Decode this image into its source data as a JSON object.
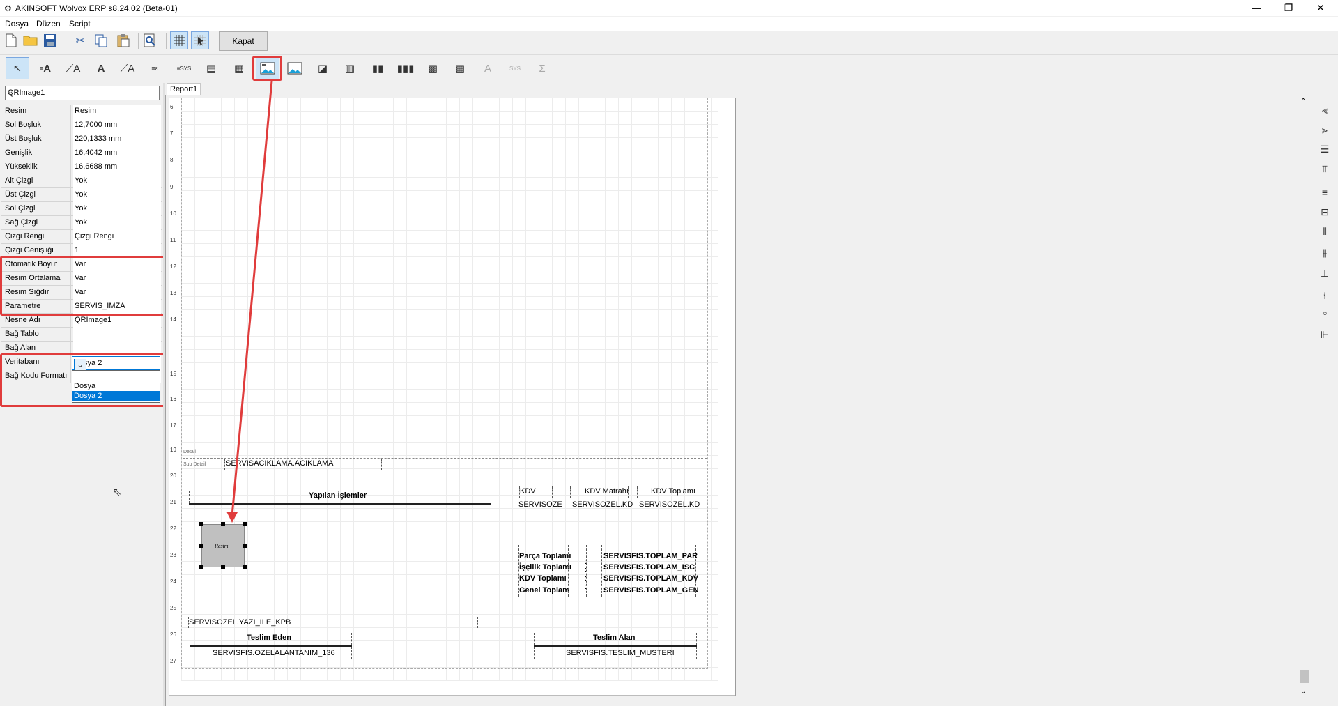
{
  "window": {
    "title": "AKINSOFT Wolvox ERP s8.24.02 (Beta-01)",
    "minimize_label": "—",
    "restore_label": "❐",
    "close_label": "✕"
  },
  "menu": {
    "items": [
      "Dosya",
      "Düzen",
      "Script"
    ]
  },
  "toolbar": {
    "close_button": "Kapat"
  },
  "object_selector": {
    "value": "QRImage1"
  },
  "properties": [
    {
      "name": "Resim",
      "value": "Resim"
    },
    {
      "name": "Sol Boşluk",
      "value": "12,7000 mm"
    },
    {
      "name": "Üst Boşluk",
      "value": "220,1333 mm"
    },
    {
      "name": "Genişlik",
      "value": "16,4042 mm"
    },
    {
      "name": "Yükseklik",
      "value": "16,6688 mm"
    },
    {
      "name": "Alt Çizgi",
      "value": "Yok"
    },
    {
      "name": "Üst Çizgi",
      "value": "Yok"
    },
    {
      "name": "Sol Çizgi",
      "value": "Yok"
    },
    {
      "name": "Sağ Çizgi",
      "value": "Yok"
    },
    {
      "name": "Çizgi Rengi",
      "value": "Çizgi Rengi"
    },
    {
      "name": "Çizgi Genişliği",
      "value": "1"
    },
    {
      "name": "Otomatik Boyut",
      "value": "Var"
    },
    {
      "name": "Resim Ortalama",
      "value": "Var"
    },
    {
      "name": "Resim Sığdır",
      "value": "Var"
    },
    {
      "name": "Parametre",
      "value": "SERVIS_IMZA"
    },
    {
      "name": "Nesne Adı",
      "value": "QRImage1"
    },
    {
      "name": "Bağ Tablo",
      "value": ""
    },
    {
      "name": "Bağ Alan",
      "value": ""
    },
    {
      "name": "Veritabanı",
      "value": ""
    },
    {
      "name": "Bağ Kodu Formatı",
      "value": ""
    }
  ],
  "veritabani_dropdown": {
    "value": "Dosya 2",
    "options": [
      "",
      "Dosya",
      "Dosya 2"
    ],
    "selected": "Dosya 2"
  },
  "tabs": [
    "Report1"
  ],
  "ruler_numbers": [
    "6",
    "7",
    "8",
    "9",
    "10",
    "11",
    "12",
    "13",
    "14",
    "15",
    "16",
    "17",
    "18",
    "19",
    "20",
    "21",
    "22",
    "23",
    "24",
    "25",
    "26",
    "27"
  ],
  "bands": {
    "detail": "Detail",
    "subdetail": "Sub Detail"
  },
  "report": {
    "servis_aciklama": "SERVISACIKLAMA.ACIKLAMA",
    "yapilan_islemler": "Yapılan İşlemler",
    "kdv": "KDV",
    "kdv_matrahi": "KDV Matrahı",
    "kdv_toplami": "KDV Toplamı",
    "servisoze": "SERVISOZE",
    "servisozel_kd1": "SERVISOZEL.KD",
    "servisozel_kd2": "SERVISOZEL.KD",
    "image_label": "Resim",
    "parca_toplami": "Parça Toplamı",
    "iscilik_toplami": "İşçilik Toplamı",
    "kdv_toplami2": "KDV Toplamı",
    "genel_toplam": "Genel Toplam",
    "colon1": ":",
    "colon2": ":",
    "colon3": ":",
    "colon4": ":",
    "toplam_par": "SERVISFIS.TOPLAM_PAR",
    "toplam_isc": "SERVISFIS.TOPLAM_ISC",
    "toplam_kdv": "SERVISFIS.TOPLAM_KDV",
    "toplam_gen": "SERVISFIS.TOPLAM_GEN",
    "yazi_ile": "SERVISOZEL.YAZI_ILE_KPB",
    "teslim_eden": "Teslim Eden",
    "teslim_alan": "Teslim Alan",
    "ozel_alan": "SERVISFIS.OZELALANTANIM_136",
    "teslim_musteri": "SERVISFIS.TESLIM_MUSTERI"
  },
  "colors": {
    "highlight": "#e03c3c",
    "selection": "#0078d7"
  },
  "icons": {
    "app": "app-icon",
    "new": "new-file-icon",
    "open": "open-folder-icon",
    "save": "save-disk-icon",
    "cut": "scissors-icon",
    "copy": "copy-icon",
    "paste": "paste-icon",
    "preview": "preview-icon",
    "grid": "grid-icon",
    "snap": "snap-icon"
  }
}
